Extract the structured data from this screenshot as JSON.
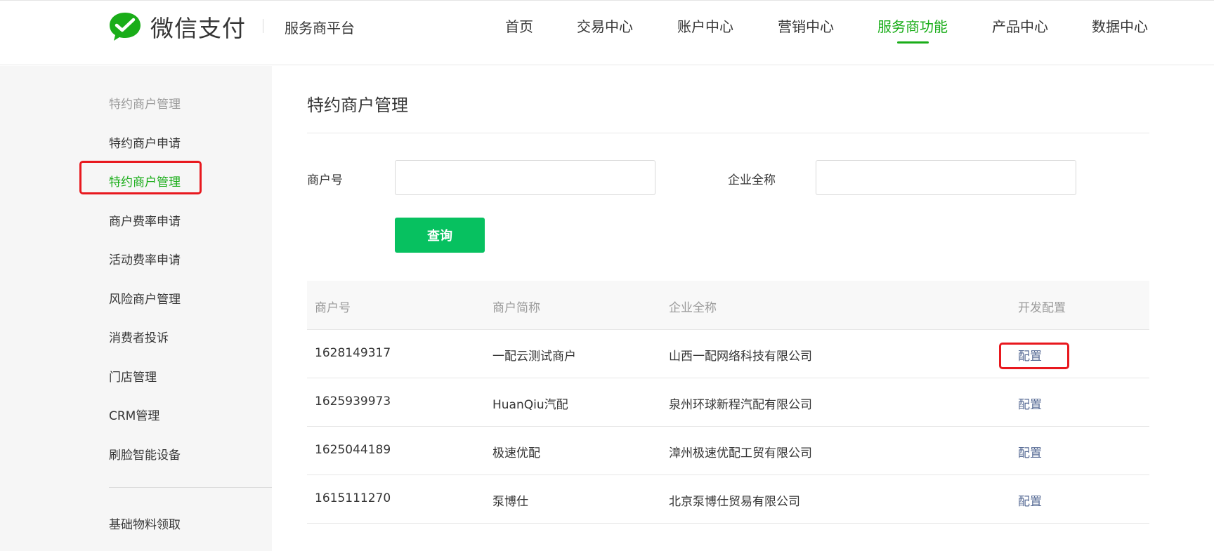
{
  "header": {
    "logo_text": "微信支付",
    "platform": "服务商平台",
    "nav": [
      {
        "label": "首页",
        "active": false
      },
      {
        "label": "交易中心",
        "active": false
      },
      {
        "label": "账户中心",
        "active": false
      },
      {
        "label": "营销中心",
        "active": false
      },
      {
        "label": "服务商功能",
        "active": true
      },
      {
        "label": "产品中心",
        "active": false
      },
      {
        "label": "数据中心",
        "active": false
      }
    ]
  },
  "sidebar": {
    "heading": "特约商户管理",
    "items": [
      {
        "label": "特约商户申请",
        "active": false
      },
      {
        "label": "特约商户管理",
        "active": true,
        "highlighted": true
      },
      {
        "label": "商户费率申请",
        "active": false
      },
      {
        "label": "活动费率申请",
        "active": false
      },
      {
        "label": "风险商户管理",
        "active": false
      },
      {
        "label": "消费者投诉",
        "active": false
      },
      {
        "label": "门店管理",
        "active": false
      },
      {
        "label": "CRM管理",
        "active": false
      },
      {
        "label": "刷脸智能设备",
        "active": false
      }
    ],
    "footer_item": "基础物料领取"
  },
  "main": {
    "title": "特约商户管理",
    "filters": {
      "merchant_no_label": "商户号",
      "merchant_no_value": "",
      "company_label": "企业全称",
      "company_value": "",
      "query_button": "查询"
    },
    "table": {
      "columns": [
        "商户号",
        "商户简称",
        "企业全称",
        "开发配置"
      ],
      "rows": [
        {
          "merchant_no": "1628149317",
          "short_name": "一配云测试商户",
          "company": "山西一配网络科技有限公司",
          "action": "配置",
          "highlighted": true
        },
        {
          "merchant_no": "1625939973",
          "short_name": "HuanQiu汽配",
          "company": "泉州环球新程汽配有限公司",
          "action": "配置",
          "highlighted": false
        },
        {
          "merchant_no": "1625044189",
          "short_name": "极速优配",
          "company": "漳州极速优配工贸有限公司",
          "action": "配置",
          "highlighted": false
        },
        {
          "merchant_no": "1615111270",
          "short_name": "泵博仕",
          "company": "北京泵博仕贸易有限公司",
          "action": "配置",
          "highlighted": false
        }
      ]
    }
  },
  "colors": {
    "accent": "#1aad19",
    "button": "#07c160",
    "link": "#576b95",
    "highlight_box": "#e8181e"
  }
}
